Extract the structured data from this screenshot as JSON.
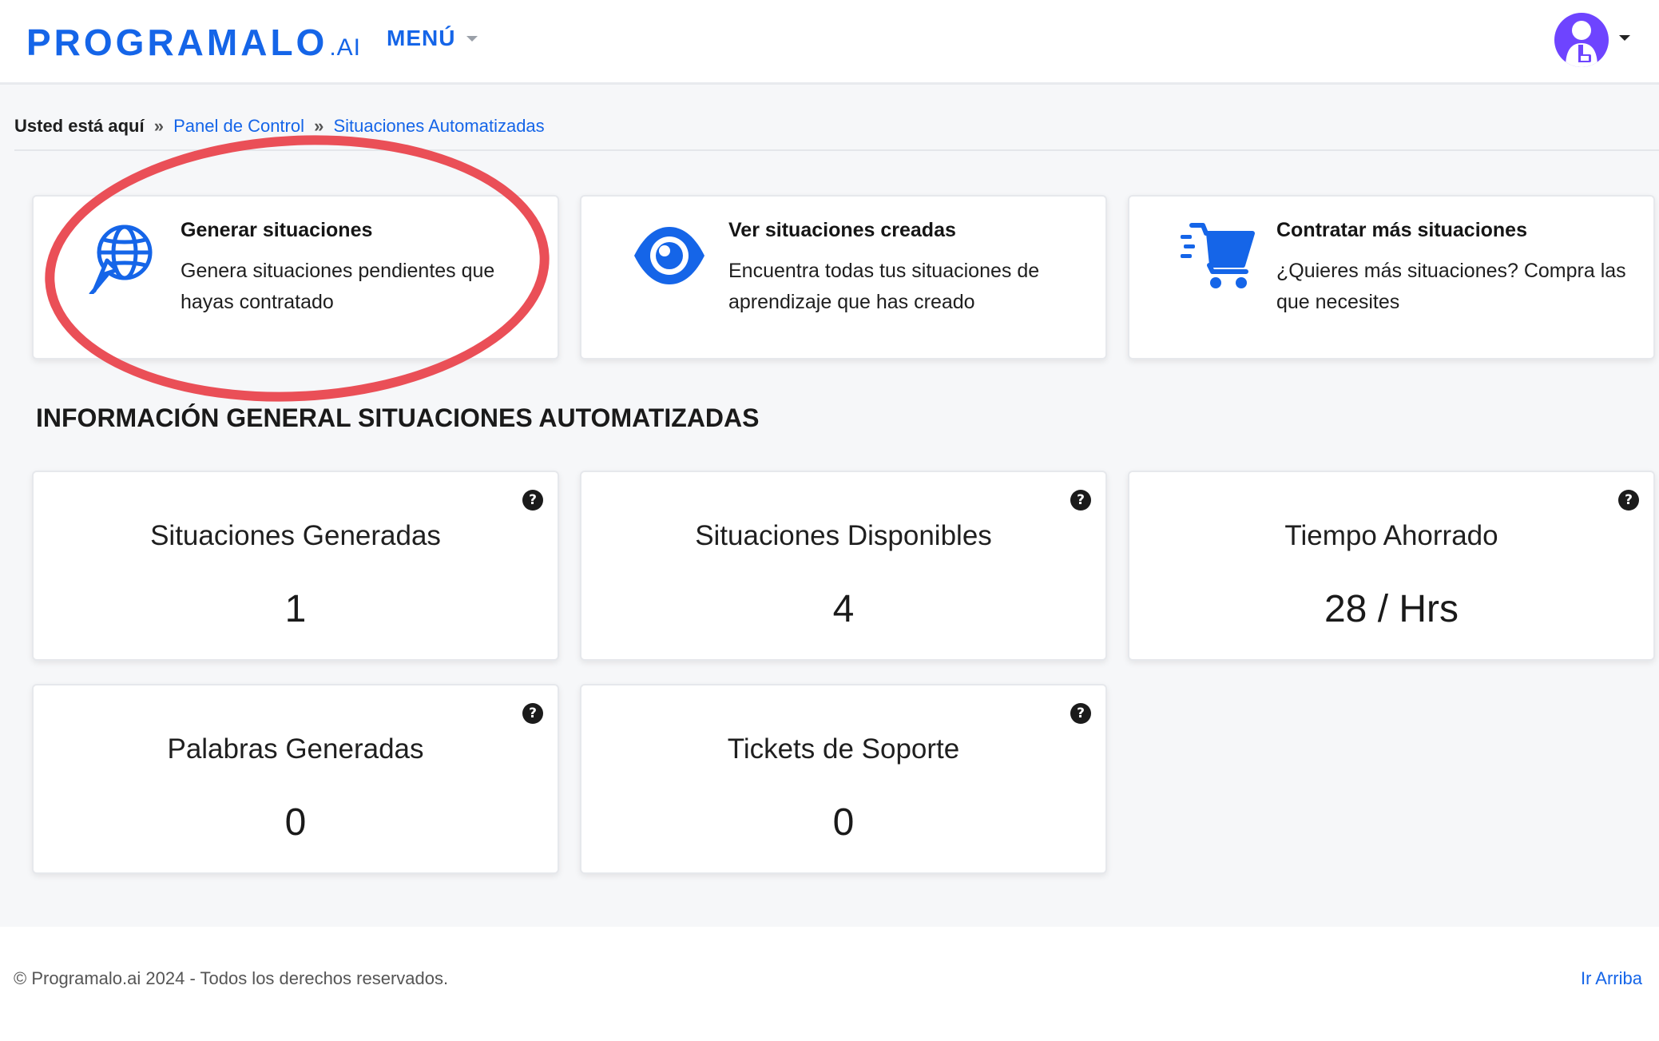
{
  "header": {
    "logo_main": "PROGRAMALO",
    "logo_suffix": ".AI",
    "menu_label": "MENÚ"
  },
  "breadcrumb": {
    "label": "Usted está aquí",
    "separator": "»",
    "items": [
      "Panel de Control",
      "Situaciones Automatizadas"
    ]
  },
  "actions": [
    {
      "title": "Generar situaciones",
      "description": "Genera situaciones pendientes que hayas contratado",
      "icon": "globe-cursor-icon"
    },
    {
      "title": "Ver situaciones creadas",
      "description": "Encuentra todas tus situaciones de aprendizaje que has creado",
      "icon": "eye-icon"
    },
    {
      "title": "Contratar más situaciones",
      "description": "¿Quieres más situaciones? Compra las que necesites",
      "icon": "cart-icon"
    }
  ],
  "section_title": "INFORMACIÓN GENERAL SITUACIONES AUTOMATIZADAS",
  "stats": [
    {
      "title": "Situaciones Generadas",
      "value": "1"
    },
    {
      "title": "Situaciones Disponibles",
      "value": "4"
    },
    {
      "title": "Tiempo Ahorrado",
      "value": "28 / Hrs"
    },
    {
      "title": "Palabras Generadas",
      "value": "0"
    },
    {
      "title": "Tickets de Soporte",
      "value": "0"
    }
  ],
  "help_glyph": "?",
  "footer": {
    "copyright": "© Programalo.ai 2024 - Todos los derechos reservados.",
    "back_to_top": "Ir Arriba"
  },
  "colors": {
    "accent": "#1565e8",
    "avatar": "#6e44ff",
    "highlight": "#ea4f57"
  }
}
